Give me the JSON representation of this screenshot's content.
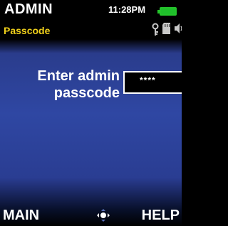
{
  "header": {
    "title": "ADMIN",
    "subtitle": "Passcode",
    "time": "11:28PM"
  },
  "status_icons": [
    "key-icon",
    "sd-card-icon",
    "sound-icon",
    "battery-icon"
  ],
  "prompt": {
    "line1": "Enter admin",
    "line2": "passcode"
  },
  "passcode_field": {
    "value": "****"
  },
  "softkeys": {
    "left": "MAIN",
    "right": "HELP"
  },
  "colors": {
    "subtitle": "#f2d21b",
    "battery": "#24c42b",
    "background_blue": "#2f47a3"
  }
}
